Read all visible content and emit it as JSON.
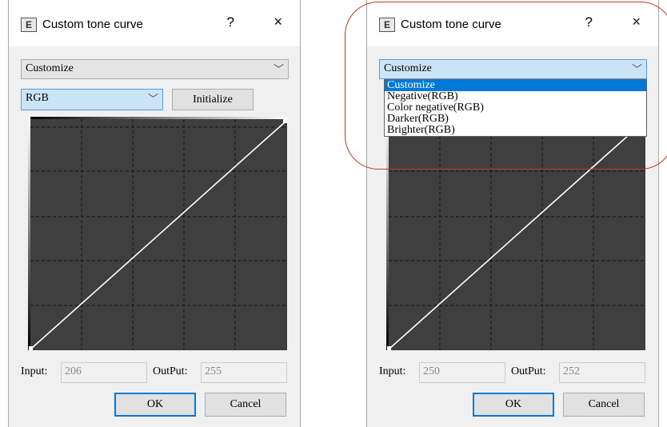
{
  "dialogs": [
    {
      "title": "Custom tone curve",
      "help": "?",
      "close": "×",
      "preset_value": "Customize",
      "channel_value": "RGB",
      "initialize_label": "Initialize",
      "input_label": "Input:",
      "input_value": "206",
      "output_label": "OutPut:",
      "output_value": "255",
      "ok_label": "OK",
      "cancel_label": "Cancel"
    },
    {
      "title": "Custom tone curve",
      "help": "?",
      "close": "×",
      "preset_value": "Customize",
      "preset_options": [
        "Customize",
        "Negative(RGB)",
        "Color negative(RGB)",
        "Darker(RGB)",
        "Brighter(RGB)"
      ],
      "selected_option_index": 0,
      "input_label": "Input:",
      "input_value": "250",
      "output_label": "OutPut:",
      "output_value": "252",
      "ok_label": "OK",
      "cancel_label": "Cancel"
    }
  ],
  "icons": {
    "app": "E",
    "dropdown_arrow": "chevron-down-icon"
  },
  "colors": {
    "curve_background": "#3f3f3f",
    "grid_line": "#1a1a1a",
    "curve_line": "#ffffff",
    "selection": "#0078d7",
    "focus_combo": "#cce4f7",
    "annotation": "#c0392b"
  }
}
